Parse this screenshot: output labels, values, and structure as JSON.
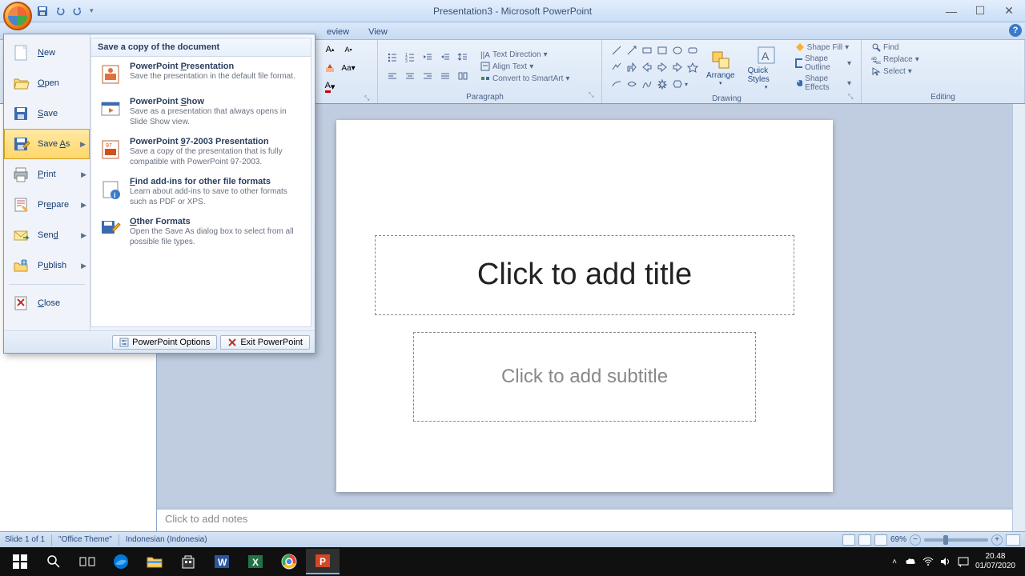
{
  "titlebar": {
    "title": "Presentation3 - Microsoft PowerPoint"
  },
  "qat_icons": [
    "save-icon",
    "undo-icon",
    "redo-icon"
  ],
  "ribbon_tabs_visible": [
    "eview",
    "View"
  ],
  "office_menu": {
    "left": [
      {
        "label": "New",
        "icon": "page-new-icon",
        "submenu": false
      },
      {
        "label": "Open",
        "icon": "folder-open-icon",
        "submenu": false
      },
      {
        "label": "Save",
        "icon": "save-icon",
        "submenu": false
      },
      {
        "label": "Save As",
        "icon": "save-as-icon",
        "submenu": true,
        "highlight": true
      },
      {
        "label": "Print",
        "icon": "printer-icon",
        "submenu": true
      },
      {
        "label": "Prepare",
        "icon": "prepare-icon",
        "submenu": true
      },
      {
        "label": "Send",
        "icon": "send-icon",
        "submenu": true
      },
      {
        "label": "Publish",
        "icon": "publish-icon",
        "submenu": true
      },
      {
        "label": "Close",
        "icon": "close-doc-icon",
        "submenu": false
      }
    ],
    "right_header": "Save a copy of the document",
    "right_items": [
      {
        "title": "PowerPoint Presentation",
        "desc": "Save the presentation in the default file format.",
        "icon": "pptx-icon"
      },
      {
        "title": "PowerPoint Show",
        "desc": "Save as a presentation that always opens in Slide Show view.",
        "icon": "ppsx-icon"
      },
      {
        "title": "PowerPoint 97-2003 Presentation",
        "desc": "Save a copy of the presentation that is fully compatible with PowerPoint 97-2003.",
        "icon": "ppt97-icon"
      },
      {
        "title": "Find add-ins for other file formats",
        "desc": "Learn about add-ins to save to other formats such as PDF or XPS.",
        "icon": "addins-icon"
      },
      {
        "title": "Other Formats",
        "desc": "Open the Save As dialog box to select from all possible file types.",
        "icon": "other-formats-icon"
      }
    ],
    "footer": {
      "options": "PowerPoint Options",
      "exit": "Exit PowerPoint"
    }
  },
  "ribbon_groups": {
    "paragraph": "Paragraph",
    "drawing": "Drawing",
    "editing": "Editing",
    "text_direction": "Text Direction",
    "align_text": "Align Text",
    "convert_smartart": "Convert to SmartArt",
    "arrange": "Arrange",
    "quick_styles": "Quick Styles",
    "shape_fill": "Shape Fill",
    "shape_outline": "Shape Outline",
    "shape_effects": "Shape Effects",
    "find": "Find",
    "replace": "Replace",
    "select": "Select"
  },
  "slide": {
    "title_placeholder": "Click to add title",
    "subtitle_placeholder": "Click to add subtitle",
    "notes_placeholder": "Click to add notes"
  },
  "statusbar": {
    "slide_info": "Slide 1 of 1",
    "theme": "\"Office Theme\"",
    "language": "Indonesian (Indonesia)",
    "zoom": "69%"
  },
  "tray": {
    "time": "20.48",
    "date": "01/07/2020"
  }
}
